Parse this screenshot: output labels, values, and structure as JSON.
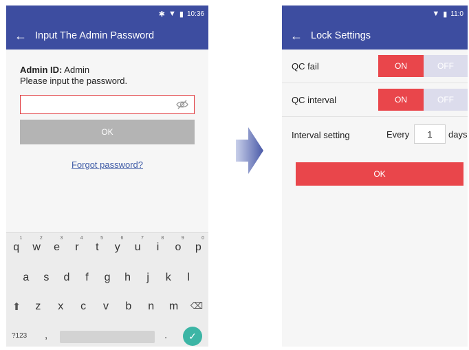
{
  "left_screen": {
    "status": {
      "time": "10:36",
      "icons": [
        "bluetooth-icon",
        "wifi-icon",
        "battery-icon"
      ]
    },
    "appbar": {
      "title": "Input The Admin Password"
    },
    "admin_id_label": "Admin ID:",
    "admin_id_value": "Admin",
    "prompt": "Please input the password.",
    "password_value": "",
    "ok_label": "OK",
    "forgot_label": "Forgot password?",
    "keyboard": {
      "row1": [
        "q",
        "w",
        "e",
        "r",
        "t",
        "y",
        "u",
        "i",
        "o",
        "p"
      ],
      "row1_hints": [
        "1",
        "2",
        "3",
        "4",
        "5",
        "6",
        "7",
        "8",
        "9",
        "0"
      ],
      "row2": [
        "a",
        "s",
        "d",
        "f",
        "g",
        "h",
        "j",
        "k",
        "l"
      ],
      "row3": [
        "z",
        "x",
        "c",
        "v",
        "b",
        "n",
        "m"
      ],
      "symbols_label": "?123",
      "comma": ",",
      "period": "."
    }
  },
  "right_screen": {
    "status": {
      "time": "11:0",
      "icons": [
        "wifi-icon",
        "battery-icon"
      ]
    },
    "appbar": {
      "title": "Lock Settings"
    },
    "settings": [
      {
        "label": "QC fail",
        "on": "ON",
        "off": "OFF",
        "state": "on"
      },
      {
        "label": "QC interval",
        "on": "ON",
        "off": "OFF",
        "state": "on"
      }
    ],
    "interval": {
      "label": "Interval setting",
      "prefix": "Every",
      "value": "1",
      "suffix": "days"
    },
    "ok_label": "OK"
  },
  "colors": {
    "appbar": "#3d4da0",
    "accent_red": "#e9464b",
    "disabled_grey": "#b4b4b4",
    "done_teal": "#3cb5a5",
    "link_blue": "#3d5aa6"
  }
}
